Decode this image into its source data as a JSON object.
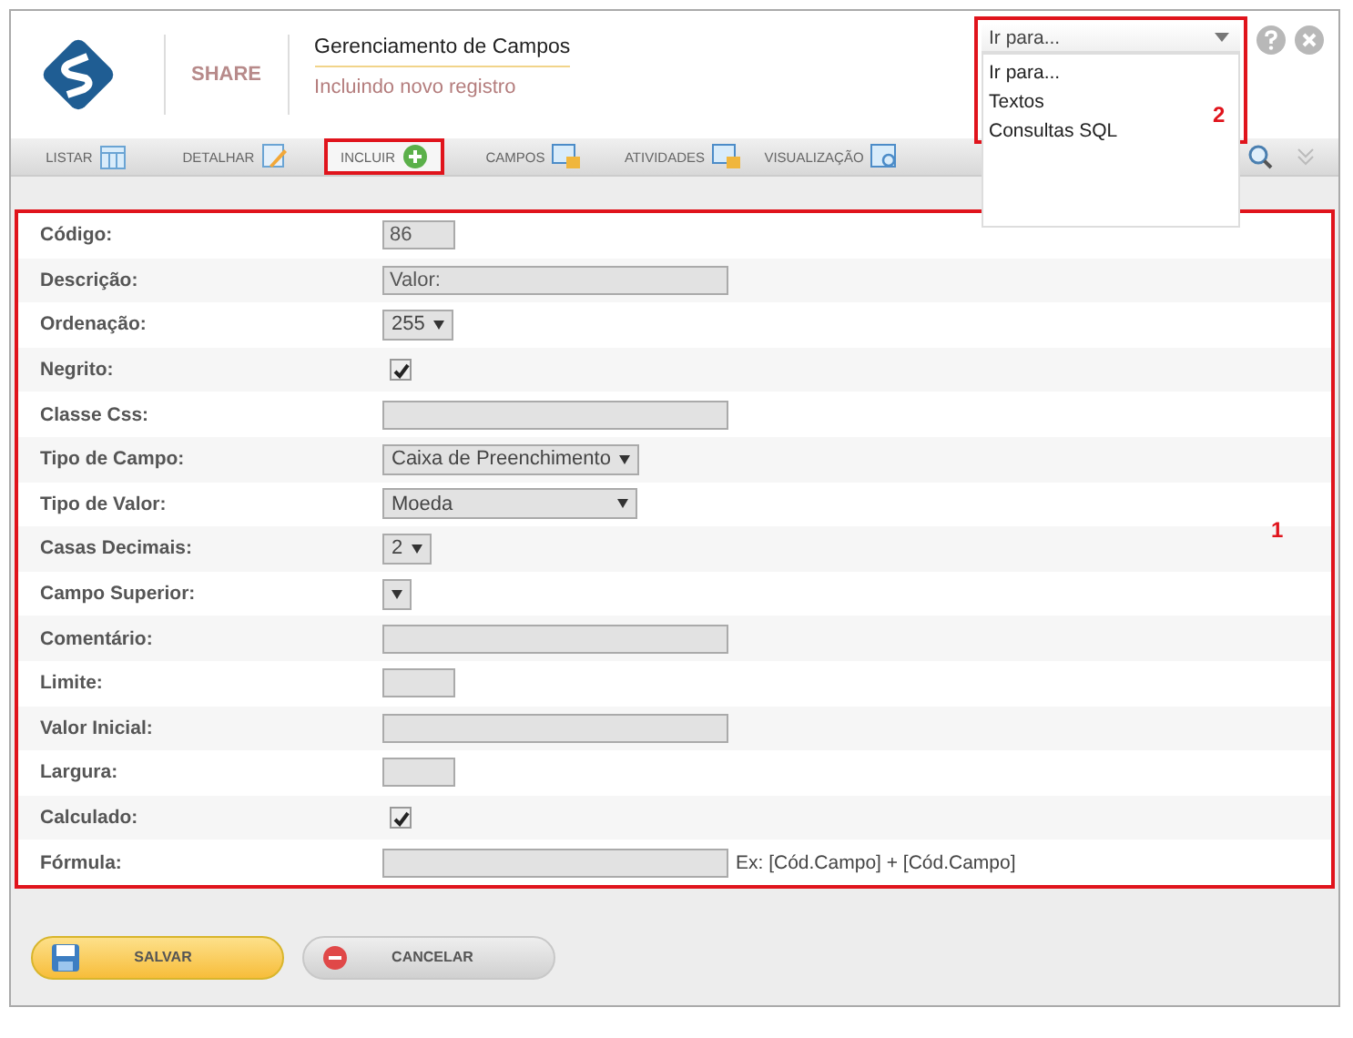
{
  "header": {
    "brand": "SHARE",
    "title": "Gerenciamento de Campos",
    "subtitle": "Incluindo novo registro"
  },
  "goto": {
    "value": "Ir para...",
    "expanded": true,
    "options": [
      "Ir para...",
      "Textos",
      "Consultas SQL"
    ],
    "mark": "2"
  },
  "tabs": [
    {
      "label": "LISTAR",
      "selected": false
    },
    {
      "label": "DETALHAR",
      "selected": false
    },
    {
      "label": "INCLUIR",
      "selected": true
    },
    {
      "label": "CAMPOS",
      "selected": false
    },
    {
      "label": "ATIVIDADES",
      "selected": false
    },
    {
      "label": "VISUALIZAÇÃO",
      "selected": false
    }
  ],
  "form": {
    "mark": "1",
    "rows": [
      {
        "label": "Código:",
        "kind": "short-text",
        "value": "86"
      },
      {
        "label": "Descrição:",
        "kind": "text",
        "value": "Valor:"
      },
      {
        "label": "Ordenação:",
        "kind": "select",
        "value": "255"
      },
      {
        "label": "Negrito:",
        "kind": "checkbox",
        "checked": true
      },
      {
        "label": "Classe Css:",
        "kind": "text"
      },
      {
        "label": "Tipo de Campo:",
        "kind": "select",
        "value": "Caixa de Preenchimento"
      },
      {
        "label": "Tipo de Valor:",
        "kind": "wide-select",
        "value": "Moeda"
      },
      {
        "label": "Casas Decimais:",
        "kind": "select",
        "value": "2"
      },
      {
        "label": "Campo Superior:",
        "kind": "select"
      },
      {
        "label": "Comentário:",
        "kind": "text"
      },
      {
        "label": "Limite:",
        "kind": "short-text"
      },
      {
        "label": "Valor Inicial:",
        "kind": "text"
      },
      {
        "label": "Largura:",
        "kind": "short-text"
      },
      {
        "label": "Calculado:",
        "kind": "checkbox",
        "checked": true
      },
      {
        "label": "Fórmula:",
        "kind": "text",
        "hint": "Ex: [Cód.Campo] + [Cód.Campo]"
      }
    ]
  },
  "buttons": [
    {
      "label": "SALVAR",
      "kind": "save"
    },
    {
      "label": "CANCELAR",
      "kind": "cancel"
    }
  ]
}
